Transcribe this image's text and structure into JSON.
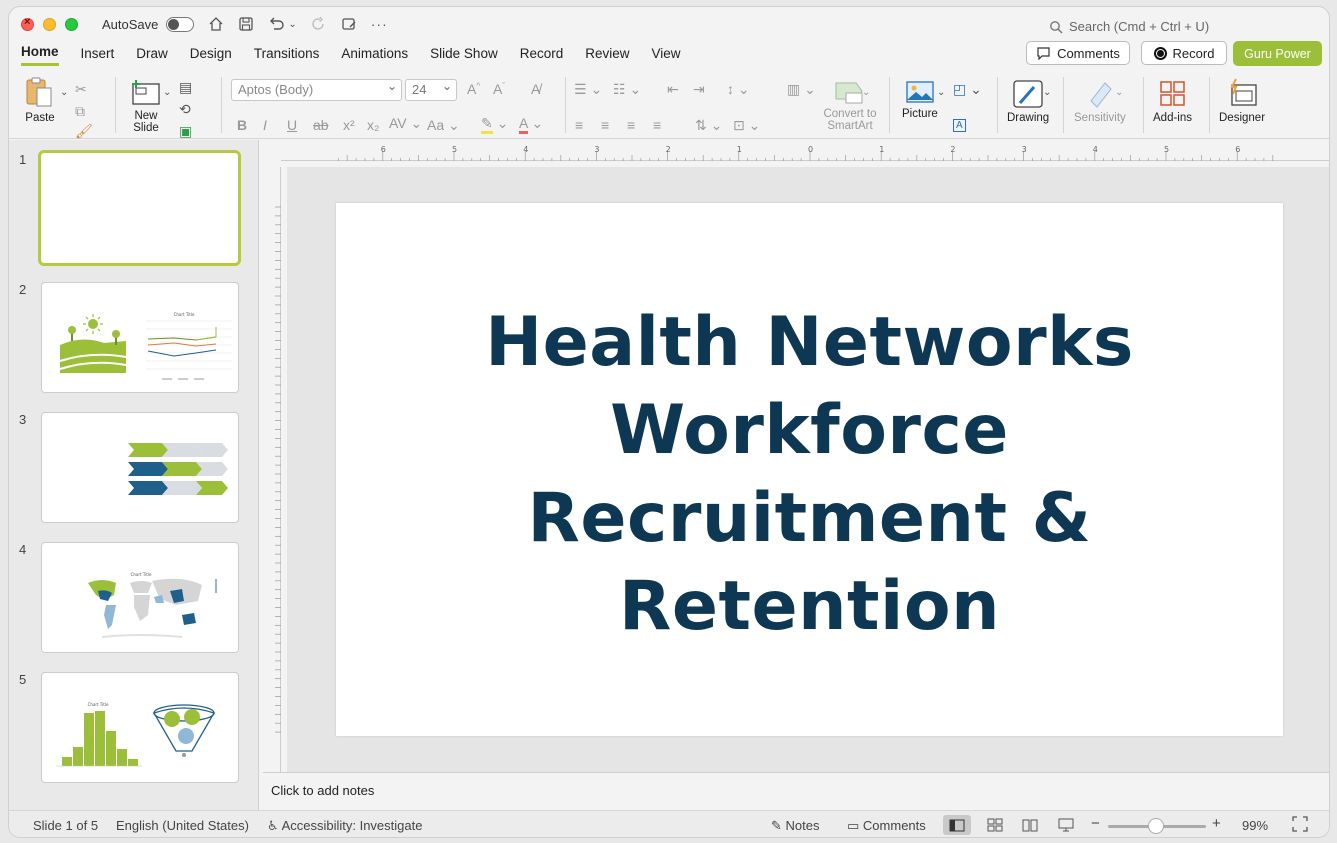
{
  "titlebar": {
    "autosave_label": "AutoSave",
    "search_placeholder": "Search (Cmd + Ctrl + U)"
  },
  "tabs": [
    {
      "label": "Home",
      "active": true
    },
    {
      "label": "Insert"
    },
    {
      "label": "Draw"
    },
    {
      "label": "Design"
    },
    {
      "label": "Transitions"
    },
    {
      "label": "Animations"
    },
    {
      "label": "Slide Show"
    },
    {
      "label": "Record"
    },
    {
      "label": "Review"
    },
    {
      "label": "View"
    }
  ],
  "header_buttons": {
    "comments": "Comments",
    "record": "Record",
    "guru": "Guru Power"
  },
  "ribbon": {
    "paste": "Paste",
    "new_slide": "New Slide",
    "font_name": "Aptos (Body)",
    "font_size": "24",
    "convert_smartart": "Convert to SmartArt",
    "picture": "Picture",
    "drawing": "Drawing",
    "sensitivity": "Sensitivity",
    "addins": "Add-ins",
    "designer": "Designer"
  },
  "slides": [
    {
      "number": "1"
    },
    {
      "number": "2"
    },
    {
      "number": "3"
    },
    {
      "number": "4"
    },
    {
      "number": "5"
    }
  ],
  "slide": {
    "title_lines": [
      "Health Networks",
      "Workforce",
      "Recruitment &",
      "Retention"
    ]
  },
  "notes_placeholder": "Click to add notes",
  "status": {
    "slide_of": "Slide 1 of 5",
    "language": "English (United States)",
    "accessibility": "Accessibility: Investigate",
    "notes": "Notes",
    "comments": "Comments",
    "zoom": "99%"
  },
  "colors": {
    "accent_green": "#9cbf3a",
    "title_navy": "#0d3752",
    "thumb_blue": "#1e5f8c"
  }
}
